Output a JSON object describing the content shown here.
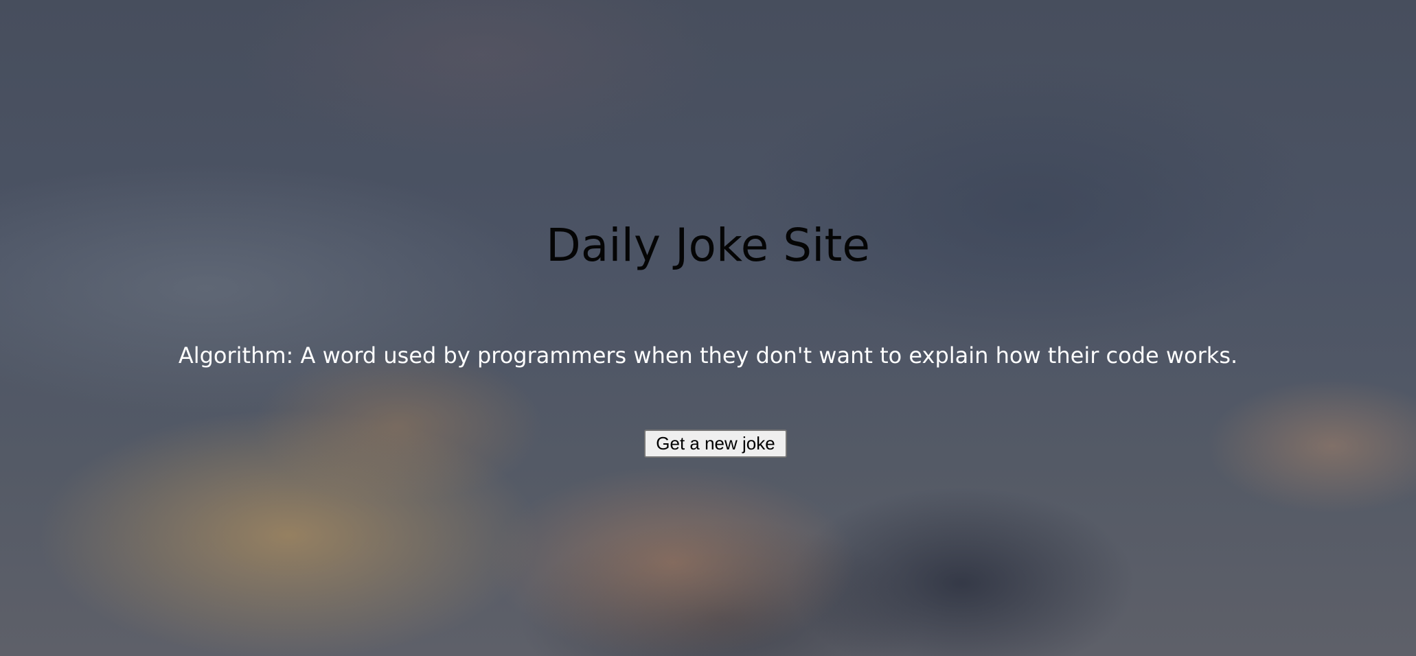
{
  "page": {
    "title": "Daily Joke Site",
    "joke_text": "Algorithm: A word used by programmers when they don't want to explain how their code works.",
    "button_label": "Get a new joke"
  },
  "colors": {
    "title": "#050505",
    "joke_text": "#ffffff",
    "button_background": "#efefef",
    "button_border": "#767676"
  }
}
